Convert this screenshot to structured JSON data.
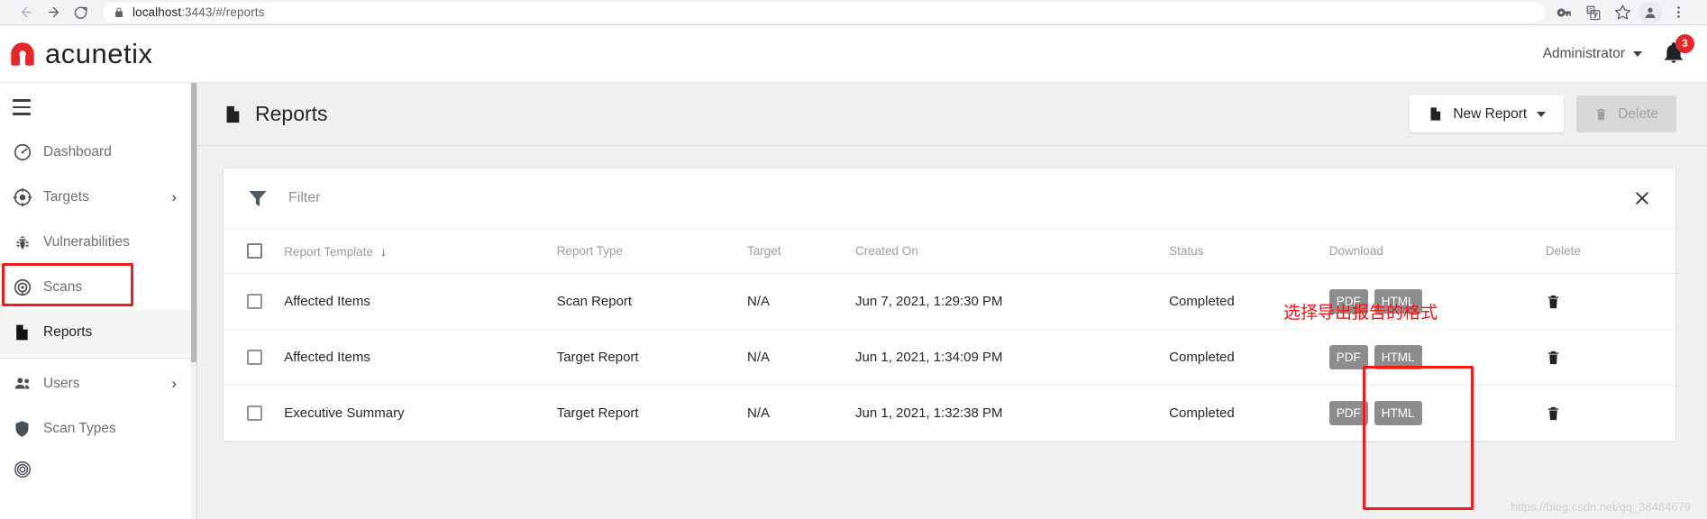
{
  "browser": {
    "url_prefix": "localhost",
    "url_suffix": ":3443/#/reports",
    "back_icon": "back-arrow-icon",
    "forward_icon": "forward-arrow-icon",
    "reload_icon": "reload-icon",
    "lock_icon": "lock-icon",
    "right_icons": [
      "key-icon",
      "translate-icon",
      "bookmark-star-icon",
      "profile-avatar-icon",
      "more-menu-icon"
    ]
  },
  "header": {
    "brand": "acunetix",
    "user": "Administrator",
    "notification_count": "3",
    "brand_color": "#e8262a"
  },
  "sidebar": {
    "items": [
      {
        "label": "Dashboard",
        "icon": "dashboard-gauge-icon",
        "chevron": false,
        "active": false
      },
      {
        "label": "Targets",
        "icon": "target-crosshair-icon",
        "chevron": true,
        "active": false
      },
      {
        "label": "Vulnerabilities",
        "icon": "bug-icon",
        "chevron": false,
        "active": false
      },
      {
        "label": "Scans",
        "icon": "scans-radar-icon",
        "chevron": false,
        "active": false
      },
      {
        "label": "Reports",
        "icon": "document-icon",
        "chevron": false,
        "active": true
      },
      {
        "label": "Users",
        "icon": "users-icon",
        "chevron": true,
        "active": false
      },
      {
        "label": "Scan Types",
        "icon": "shield-icon",
        "chevron": false,
        "active": false
      }
    ]
  },
  "page": {
    "title": "Reports",
    "title_icon": "document-icon",
    "new_report_label": "New Report",
    "new_report_icon": "document-icon",
    "delete_label": "Delete",
    "delete_icon": "trash-icon"
  },
  "filter": {
    "placeholder": "Filter",
    "value": "",
    "icon": "funnel-icon",
    "close_icon": "close-x-icon"
  },
  "table": {
    "columns": [
      "Report Template",
      "Report Type",
      "Target",
      "Created On",
      "Status",
      "Download",
      "Delete"
    ],
    "sort_column": "Report Template",
    "sort_arrow": "↓",
    "rows": [
      {
        "template": "Affected Items",
        "type": "Scan Report",
        "target": "N/A",
        "created_on": "Jun 7, 2021, 1:29:30 PM",
        "status": "Completed",
        "downloads": [
          "PDF",
          "HTML"
        ],
        "delete_icon": "trash-icon"
      },
      {
        "template": "Affected Items",
        "type": "Target Report",
        "target": "N/A",
        "created_on": "Jun 1, 2021, 1:34:09 PM",
        "status": "Completed",
        "downloads": [
          "PDF",
          "HTML"
        ],
        "delete_icon": "trash-icon"
      },
      {
        "template": "Executive Summary",
        "type": "Target Report",
        "target": "N/A",
        "created_on": "Jun 1, 2021, 1:32:38 PM",
        "status": "Completed",
        "downloads": [
          "PDF",
          "HTML"
        ],
        "delete_icon": "trash-icon"
      }
    ]
  },
  "annotations": {
    "note_text": "选择导出报告的格式",
    "note_color": "#fb1212",
    "box_color": "#f01c1c"
  },
  "watermark": "https://blog.csdn.net/qq_38484679"
}
